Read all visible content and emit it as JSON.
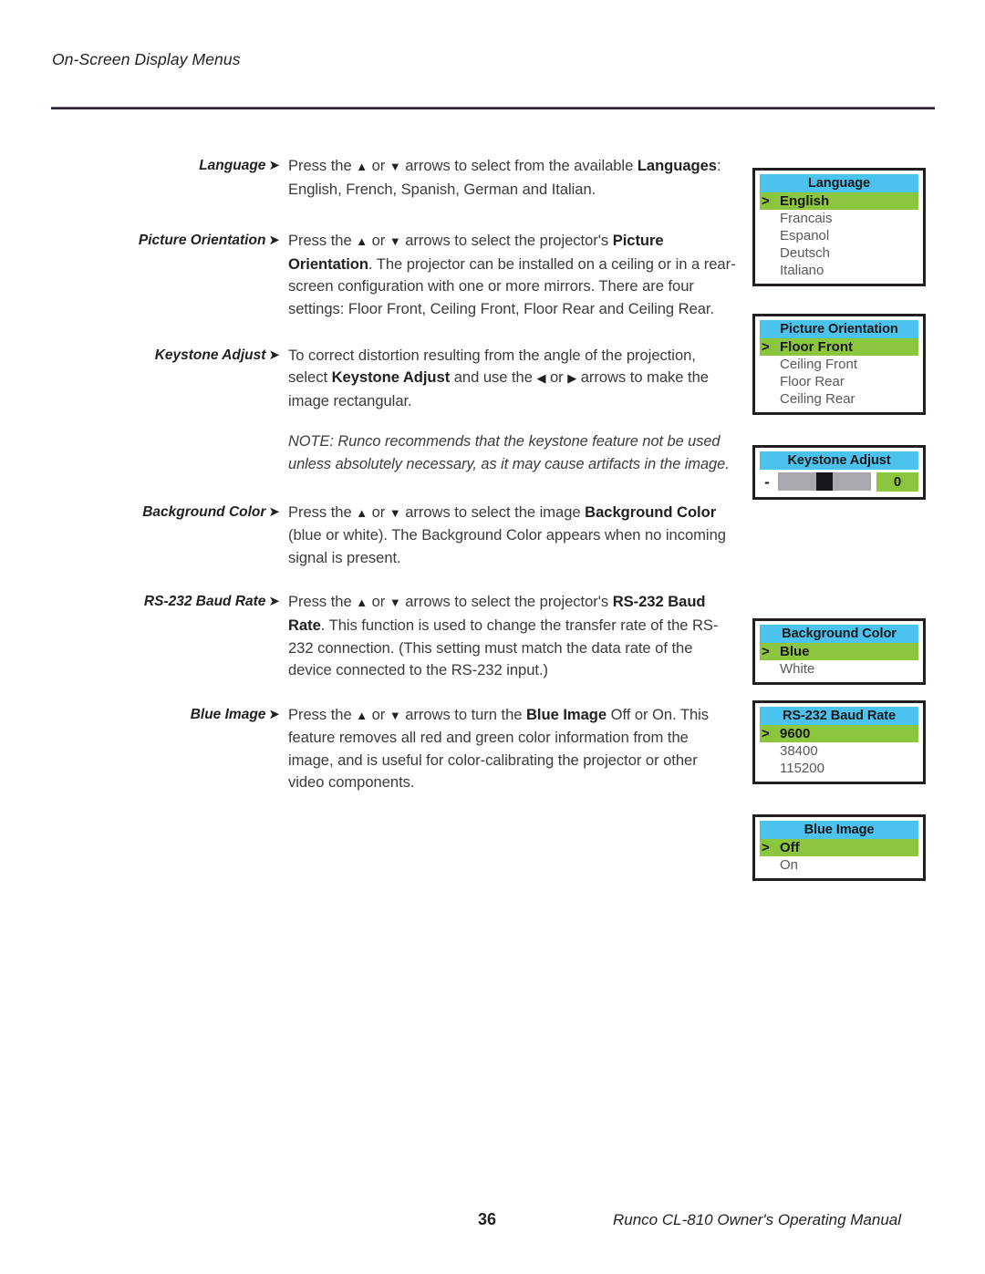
{
  "header": {
    "running_head": "On-Screen Display Menus"
  },
  "sections": [
    {
      "label": "Language",
      "arrow": "➤",
      "body_html": "Press the <span class=\"tri\">▲</span> or <span class=\"tri\">▼</span> arrows to select from the available <b>Languages</b>: English, French, Spanish, German and Italian."
    },
    {
      "label": "Picture Orientation",
      "arrow": "➤",
      "body_html": "Press the <span class=\"tri\">▲</span> or <span class=\"tri\">▼</span> arrows to select the projector's <b>Picture Orientation</b>. The projector can be installed on a ceiling or in a rear-screen configuration with one or more mirrors. There are four settings: Floor Front, Ceiling Front, Floor Rear and Ceiling Rear."
    },
    {
      "label": "Keystone Adjust",
      "arrow": "➤",
      "body_html": "To correct distortion resulting from the angle of the projection, select <b>Keystone Adjust</b> and use the <span class=\"tri\">◀</span> or <span class=\"tri\">▶</span> arrows to make the image rectangular."
    },
    {
      "label": "Background Color",
      "arrow": "➤",
      "body_html": "Press the <span class=\"tri\">▲</span> or <span class=\"tri\">▼</span> arrows to select the image <b>Background Color</b> (blue or white). The Background Color appears when no incoming signal is present."
    },
    {
      "label": "RS-232 Baud Rate",
      "arrow": "➤",
      "body_html": "Press the <span class=\"tri\">▲</span> or <span class=\"tri\">▼</span> arrows to select the projector's <b>RS-232 Baud Rate</b>. This function is used to change the transfer rate of the RS-232 connection. (This setting must match the data rate of the device connected to the RS-232 input.)"
    },
    {
      "label": "Blue Image",
      "arrow": "➤",
      "body_html": "Press the <span class=\"tri\">▲</span> or <span class=\"tri\">▼</span> arrows to turn the <b>Blue Image</b> Off or On. This feature removes all red and green color information from the image, and is useful for color-calibrating the projector or other video components."
    }
  ],
  "note": {
    "text": "NOTE: Runco recommends that the keystone feature not be used unless absolutely necessary, as it may cause artifacts in the image."
  },
  "osd_menus": [
    {
      "id": "language",
      "title": "Language",
      "type": "list",
      "marker": ">",
      "items": [
        {
          "label": "English",
          "selected": true
        },
        {
          "label": "Francais",
          "selected": false
        },
        {
          "label": "Espanol",
          "selected": false
        },
        {
          "label": "Deutsch",
          "selected": false
        },
        {
          "label": "Italiano",
          "selected": false
        }
      ]
    },
    {
      "id": "picture-orientation",
      "title": "Picture Orientation",
      "type": "list",
      "marker": ">",
      "items": [
        {
          "label": "Floor Front",
          "selected": true
        },
        {
          "label": "Ceiling Front",
          "selected": false
        },
        {
          "label": "Floor Rear",
          "selected": false
        },
        {
          "label": "Ceiling Rear",
          "selected": false
        }
      ]
    },
    {
      "id": "keystone-adjust",
      "title": "Keystone Adjust",
      "type": "slider",
      "minus_label": "-",
      "value": "0",
      "position_percent": 50
    },
    {
      "id": "background-color",
      "title": "Background Color",
      "type": "list",
      "marker": ">",
      "items": [
        {
          "label": "Blue",
          "selected": true
        },
        {
          "label": "White",
          "selected": false
        }
      ]
    },
    {
      "id": "rs232-baud-rate",
      "title": "RS-232 Baud Rate",
      "type": "list",
      "marker": ">",
      "items": [
        {
          "label": "9600",
          "selected": true
        },
        {
          "label": "38400",
          "selected": false
        },
        {
          "label": "115200",
          "selected": false
        }
      ]
    },
    {
      "id": "blue-image",
      "title": "Blue Image",
      "type": "list",
      "marker": ">",
      "items": [
        {
          "label": "Off",
          "selected": true
        },
        {
          "label": "On",
          "selected": false
        }
      ]
    }
  ],
  "footer": {
    "page_number": "36",
    "manual_title": "Runco CL-810 Owner's Operating Manual"
  },
  "colors": {
    "osd_title_bar": "#4cc3ef",
    "osd_highlight": "#8cc63e",
    "osd_border": "#231f20",
    "slider_track": "#a7a9ac",
    "slider_thumb": "#17181a",
    "rule": "#2b2430"
  }
}
